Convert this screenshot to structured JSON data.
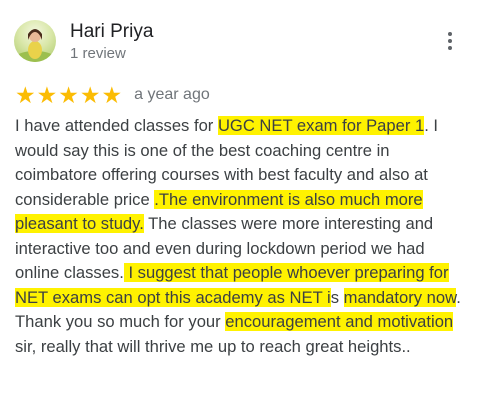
{
  "reviewer": {
    "name": "Hari Priya",
    "review_count": "1 review",
    "avatar_icon": "profile-photo-icon"
  },
  "menu": {
    "icon": "more-vert-icon"
  },
  "rating": {
    "stars": 5,
    "max": 5,
    "star_color": "#fbbc04",
    "date": "a year ago"
  },
  "review": {
    "highlight_color": "#fff200",
    "segments": [
      {
        "text": "I have attended classes for ",
        "highlight": false
      },
      {
        "text": "UGC NET exam for Paper 1",
        "highlight": true
      },
      {
        "text": ". I would say this is one of the best coaching centre in coimbatore offering courses with best faculty and also at considerable price ",
        "highlight": false
      },
      {
        "text": ".The environment is also much more pleasant to study.",
        "highlight": true
      },
      {
        "text": " The classes were more interesting and interactive too and even during lockdown period we had online classes.",
        "highlight": false
      },
      {
        "text": " I suggest that people whoever preparing for NET exams can opt this academy as NET i",
        "highlight": true
      },
      {
        "text": "s ",
        "highlight": false
      },
      {
        "text": "mandatory now",
        "highlight": true
      },
      {
        "text": ". Thank you so much for your ",
        "highlight": false
      },
      {
        "text": "encouragement and motivation",
        "highlight": true
      },
      {
        "text": " sir, really that will thrive me up to reach great heights..",
        "highlight": false
      }
    ]
  }
}
